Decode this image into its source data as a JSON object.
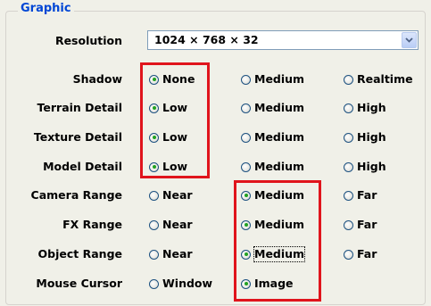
{
  "group": {
    "title": "Graphic"
  },
  "resolution": {
    "label": "Resolution",
    "value": "1024 × 768 × 32"
  },
  "rows": [
    {
      "label": "Shadow",
      "options": [
        "None",
        "Medium",
        "Realtime"
      ],
      "selected": "None"
    },
    {
      "label": "Terrain Detail",
      "options": [
        "Low",
        "Medium",
        "High"
      ],
      "selected": "Low"
    },
    {
      "label": "Texture Detail",
      "options": [
        "Low",
        "Medium",
        "High"
      ],
      "selected": "Low"
    },
    {
      "label": "Model Detail",
      "options": [
        "Low",
        "Medium",
        "High"
      ],
      "selected": "Low"
    },
    {
      "label": "Camera Range",
      "options": [
        "Near",
        "Medium",
        "Far"
      ],
      "selected": "Medium"
    },
    {
      "label": "FX Range",
      "options": [
        "Near",
        "Medium",
        "Far"
      ],
      "selected": "Medium"
    },
    {
      "label": "Object Range",
      "options": [
        "Near",
        "Medium",
        "Far"
      ],
      "selected": "Medium",
      "focused": "Medium"
    },
    {
      "label": "Mouse Cursor",
      "options": [
        "Window",
        "Image"
      ],
      "selected": "Image"
    }
  ],
  "icons": {
    "dropdown": "chevron-down-icon",
    "radio": "radio-button-icon"
  },
  "colors": {
    "group_title": "#0046d5",
    "highlight": "#e0141c",
    "radio_selected": "#21a121"
  }
}
